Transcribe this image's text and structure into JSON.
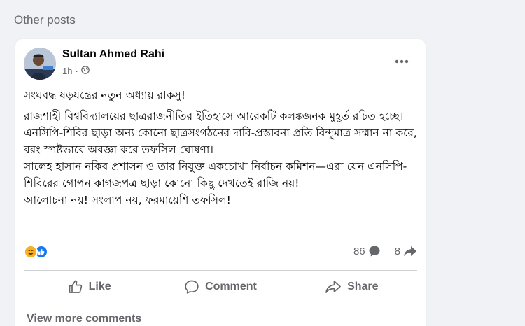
{
  "section": {
    "heading": "Other posts"
  },
  "post": {
    "author": "Sultan Ahmed Rahi",
    "time": "1h",
    "audience_icon": "globe-icon",
    "menu_icon": "more-horizontal-icon",
    "paragraphs": [
      "সংঘবদ্ধ ষড়যন্ত্রের নতুন অধ্যায় রাকসু!",
      "রাজশাহী বিশ্ববিদ্যালয়ের ছাত্ররাজনীতির ইতিহাসে আরেকটি কলঙ্কজনক মুহূর্ত রচিত হচ্ছে। এনসিপি-শিবির ছাড়া অন্য কোনো ছাত্রসংগঠনের দাবি-প্রস্তাবনা প্রতি বিন্দুমাত্র সম্মান না করে, বরং স্পষ্টভাবে অবজ্ঞা করে তফসিল ঘোষণা।",
      "সালেহ হাসান নকিব প্রশাসন ও তার নিযুক্ত একচোখা নির্বাচন কমিশন—এরা যেন এনসিপি-শিবিরের গোপন কাগজপত্র ছাড়া কোনো কিছু দেখতেই রাজি নয়!",
      "আলোচনা নয়! সংলাপ নয়, ফরমায়েশি তফসিল!"
    ],
    "reactions": {
      "icons": [
        "haha-icon",
        "like-icon"
      ]
    },
    "comments_count": "86",
    "shares_count": "8",
    "actions": {
      "like": "Like",
      "comment": "Comment",
      "share": "Share"
    },
    "view_more": "View more comments"
  },
  "colors": {
    "background": "#f0f2f5",
    "card": "#ffffff",
    "secondary_text": "#65676b",
    "like_blue": "#1877f2",
    "haha_yellow": "#f7b125"
  }
}
